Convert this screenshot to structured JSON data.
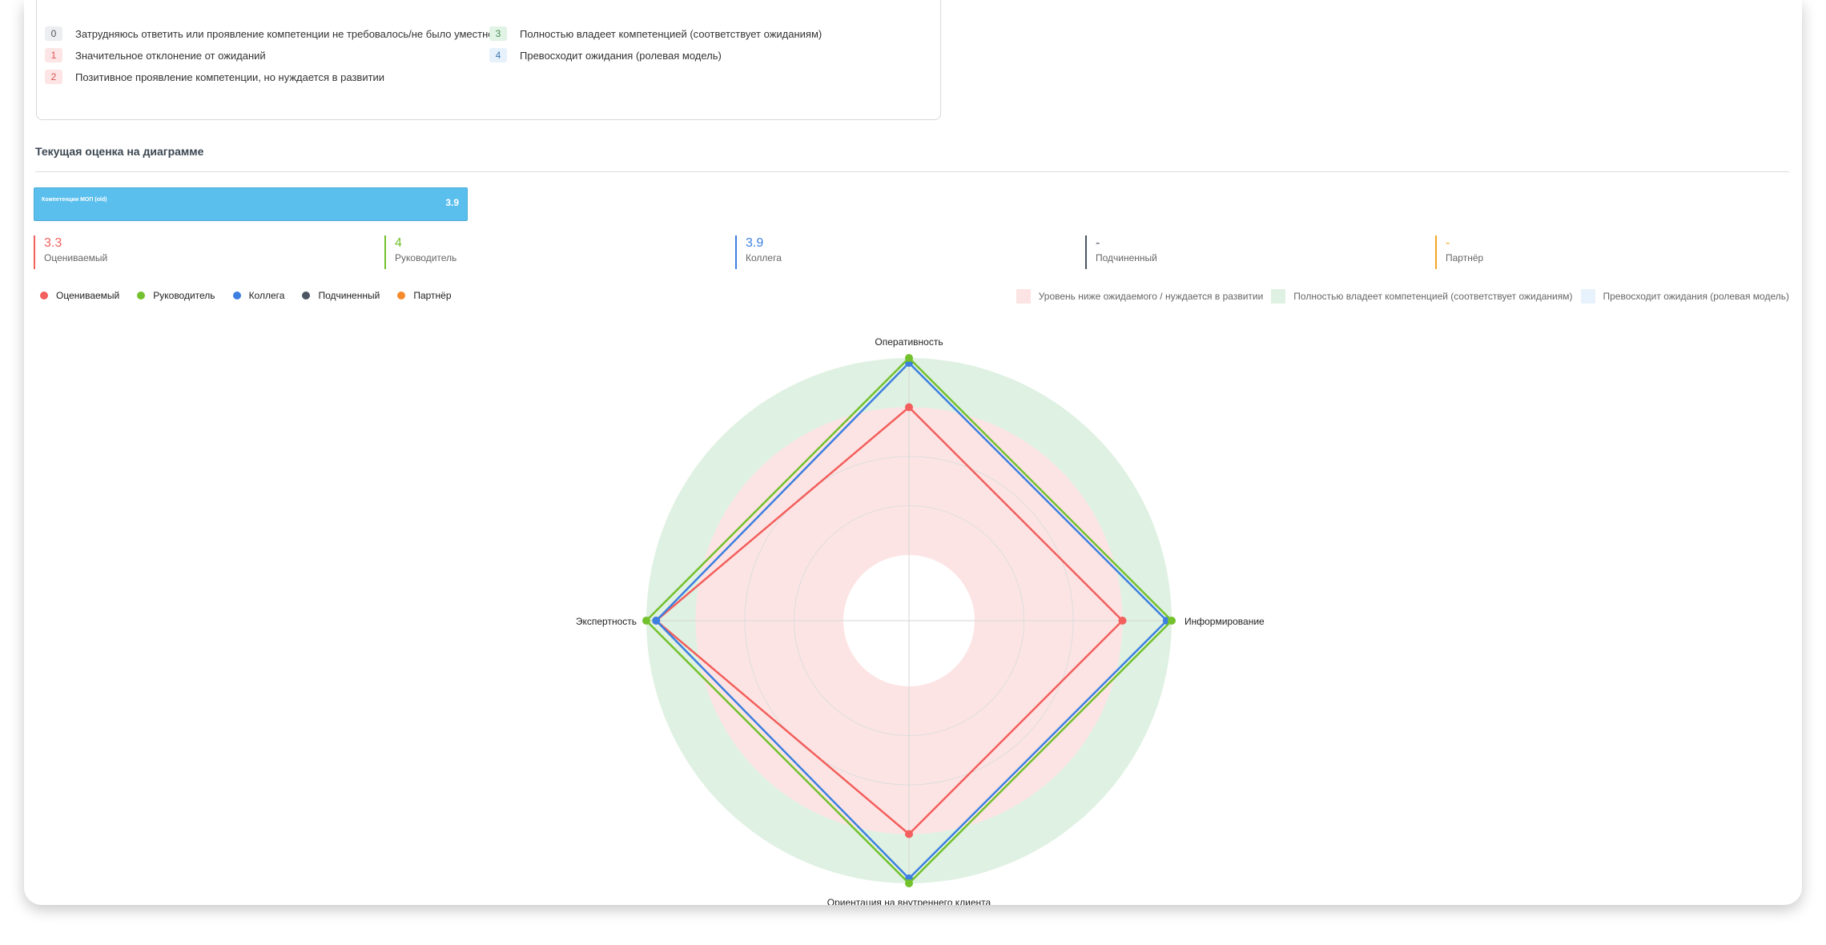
{
  "scale": {
    "items": [
      {
        "num": "0",
        "text": "Затрудняюсь ответить или проявление компетенции не требовалось/не было уместно"
      },
      {
        "num": "1",
        "text": "Значительное отклонение от ожиданий"
      },
      {
        "num": "2",
        "text": "Позитивное проявление компетенции, но нуждается в развитии"
      },
      {
        "num": "3",
        "text": "Полностью владеет компетенцией (соответствует ожиданиям)"
      },
      {
        "num": "4",
        "text": "Превосходит ожидания (ролевая модель)"
      }
    ]
  },
  "section_title": "Текущая оценка на диаграмме",
  "competency_bar": {
    "label": "Компетенции МОП (old)",
    "value": "3.9"
  },
  "metrics": [
    {
      "value": "3.3",
      "label": "Оцениваемый",
      "color": "#f25f5c"
    },
    {
      "value": "4",
      "label": "Руководитель",
      "color": "#72c12d"
    },
    {
      "value": "3.9",
      "label": "Коллега",
      "color": "#3d7fe0"
    },
    {
      "value": "-",
      "label": "Подчиненный",
      "color": "#4b5563"
    },
    {
      "value": "-",
      "label": "Партнёр",
      "color": "#f5a623"
    }
  ],
  "legend": [
    {
      "label": "Оцениваемый",
      "color": "#f25f5c"
    },
    {
      "label": "Руководитель",
      "color": "#72c12d"
    },
    {
      "label": "Коллега",
      "color": "#3d7fe0"
    },
    {
      "label": "Подчиненный",
      "color": "#4b5563"
    },
    {
      "label": "Партнёр",
      "color": "#f58b2d"
    }
  ],
  "zones": [
    {
      "label": "Уровень ниже ожидаемого / нуждается в развитии",
      "color": "#fde4e4"
    },
    {
      "label": "Полностью владеет компетенцией (соответствует ожиданиям)",
      "color": "#dff1e2"
    },
    {
      "label": "Превосходит ожидания (ролевая модель)",
      "color": "#e8f2fc"
    }
  ],
  "chart_data": {
    "type": "radar",
    "axes": [
      "Оперативность",
      "Информирование",
      "Ориентация на внутреннего клиента",
      "Экспертность"
    ],
    "rlim": [
      0,
      4
    ],
    "zones": [
      {
        "from": 0,
        "to": 3,
        "name": "Уровень ниже ожидаемого / нуждается в развитии"
      },
      {
        "from": 3,
        "to": 4,
        "name": "Полностью владеет компетенцией (соответствует ожиданиям)"
      }
    ],
    "series": [
      {
        "name": "Оцениваемый",
        "color": "#f25f5c",
        "values": [
          3,
          3,
          3,
          3.8
        ]
      },
      {
        "name": "Коллега",
        "color": "#3d7fe0",
        "values": [
          3.9,
          3.9,
          3.9,
          3.8
        ]
      },
      {
        "name": "Руководитель",
        "color": "#72c12d",
        "values": [
          4,
          4,
          4,
          4
        ]
      }
    ]
  }
}
